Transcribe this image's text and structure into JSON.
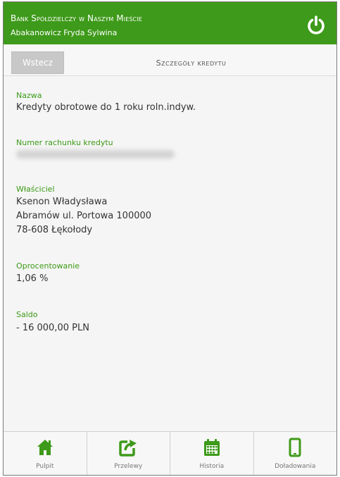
{
  "header": {
    "bank_name": "Bank Spółdzielczy w Naszym Mieście",
    "user_name": "Abakanowicz Fryda Sylwina"
  },
  "nav": {
    "back_label": "Wstecz",
    "page_title": "Szczegóły kredytu"
  },
  "details": {
    "name_label": "Nazwa",
    "name_value": "Kredyty obrotowe do 1 roku roln.indyw.",
    "account_label": "Numer rachunku kredytu",
    "owner_label": "Właściciel",
    "owner_name": "Ksenon Władysława",
    "owner_address1": "Abramów ul. Portowa 100000",
    "owner_address2": "78-608 Łękołody",
    "interest_label": "Oprocentowanie",
    "interest_value": "1,06 %",
    "balance_label": "Saldo",
    "balance_value": "- 16 000,00 PLN"
  },
  "tabs": [
    {
      "label": "Pulpit",
      "icon": "home-icon"
    },
    {
      "label": "Przelewy",
      "icon": "transfer-icon"
    },
    {
      "label": "Historia",
      "icon": "calendar-icon"
    },
    {
      "label": "Doładowania",
      "icon": "phone-icon"
    }
  ],
  "colors": {
    "brand_green": "#3e9a1a",
    "label_green": "#3b9a16"
  }
}
